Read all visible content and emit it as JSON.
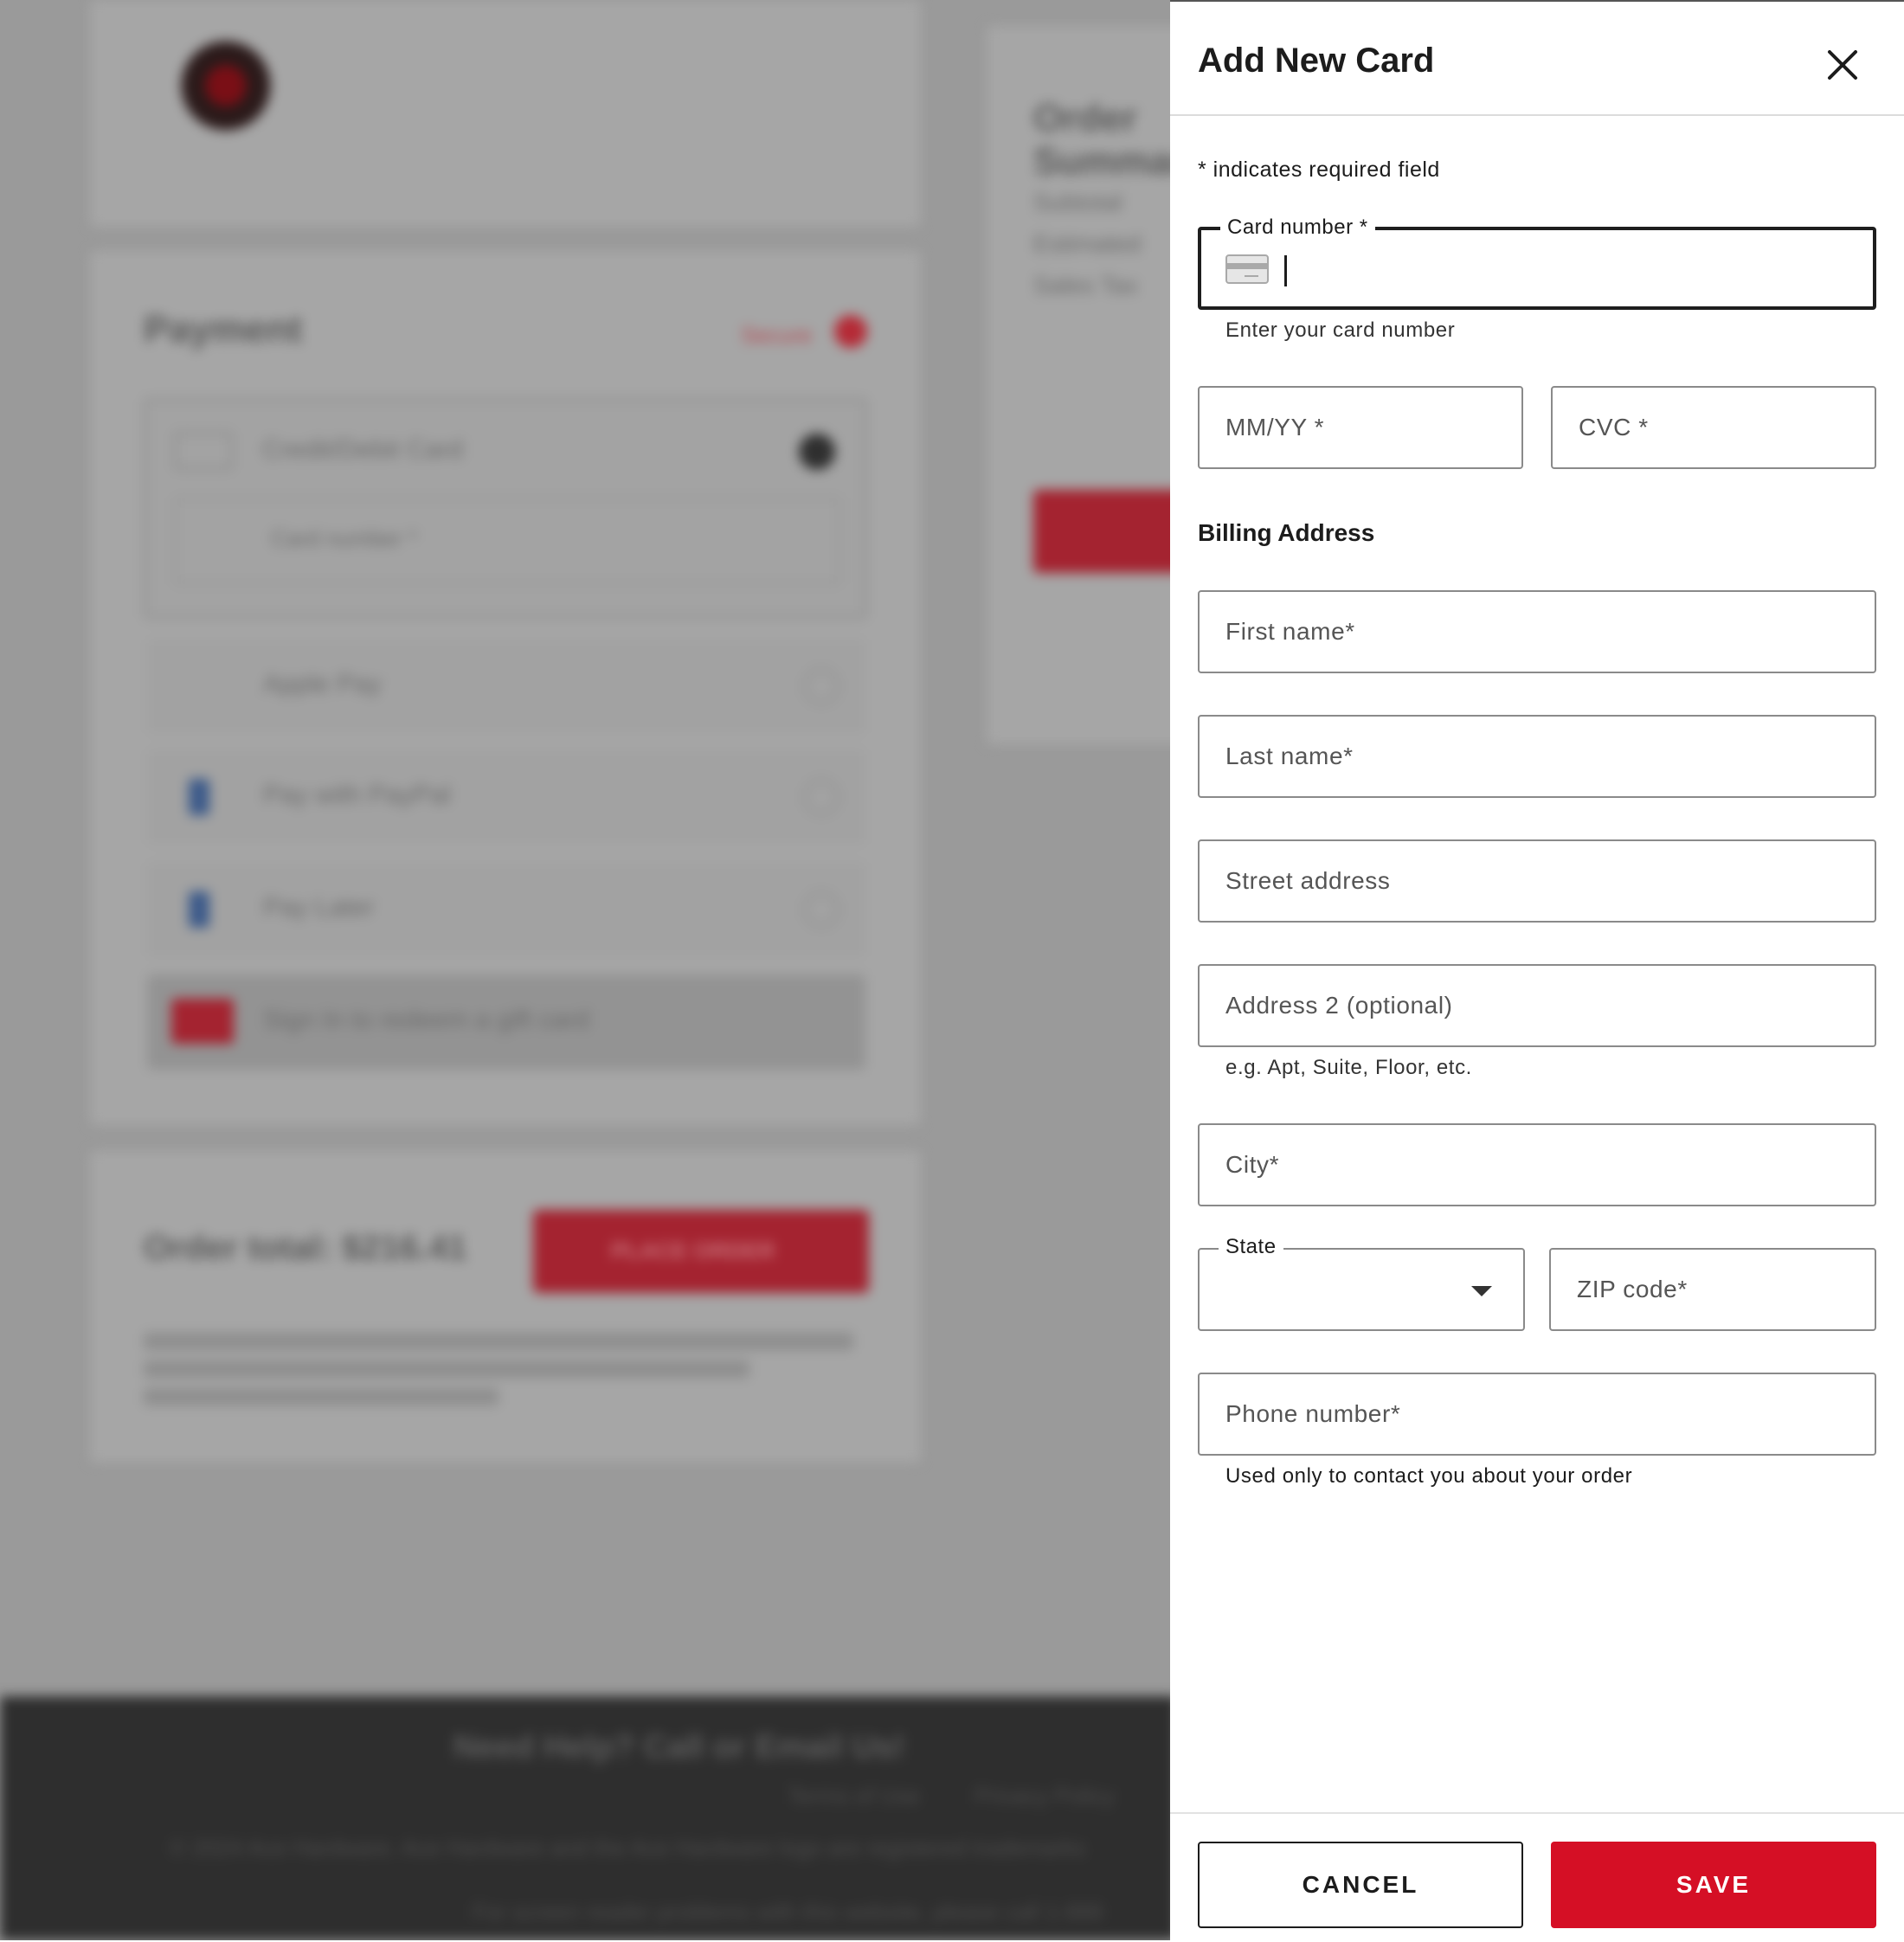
{
  "background": {
    "payment_title": "Payment",
    "secure_label": "Secure",
    "credit_card_label": "Credit/Debit Card",
    "card_number_placeholder": "Card number *",
    "apple_pay_label": "Apple Pay",
    "paypal_label": "Pay with PayPal",
    "pay_later_label": "Pay Later",
    "gift_card_text": "Sign In to redeem a gift card",
    "order_total": "Order total: $216.41",
    "place_order_label": "PLACE ORDER",
    "order_summary_title": "Order Summary",
    "subtotal_label": "Subtotal",
    "estimated_label": "Estimated",
    "sales_tax_label": "Sales Tax",
    "footer_help": "Need Help? Call or Email Us!",
    "footer_terms": "Terms of Use",
    "footer_privacy": "Privacy Policy",
    "footer_copyright": "© 2024 Ace Hardware. Ace Hardware and the Ace Hardware logo are registered trademarks",
    "footer_screen_reader": "For screen reader problems with this website, please call 1-888"
  },
  "drawer": {
    "title": "Add New Card",
    "required_note": "* indicates required field",
    "card_number": {
      "label": "Card number *",
      "value": "",
      "helper": "Enter your card number"
    },
    "expiry": {
      "placeholder": "MM/YY *"
    },
    "cvc": {
      "placeholder": "CVC *"
    },
    "billing_heading": "Billing Address",
    "first_name": {
      "placeholder": "First name*"
    },
    "last_name": {
      "placeholder": "Last name*"
    },
    "street": {
      "placeholder": "Street address"
    },
    "address2": {
      "placeholder": "Address 2 (optional)",
      "helper": "e.g. Apt, Suite, Floor, etc."
    },
    "city": {
      "placeholder": "City*"
    },
    "state": {
      "label": "State",
      "selected": ""
    },
    "zip": {
      "placeholder": "ZIP code*"
    },
    "phone": {
      "placeholder": "Phone number*",
      "helper": "Used only to contact you about your order"
    },
    "cancel_label": "CANCEL",
    "save_label": "SAVE"
  },
  "colors": {
    "primary_red": "#d50f25",
    "overlay_gray": "#9a9a9a",
    "footer_dark": "#2e2e2e"
  },
  "icons": {
    "close": "close-icon",
    "card": "credit-card-icon",
    "dropdown": "chevron-down-icon"
  }
}
